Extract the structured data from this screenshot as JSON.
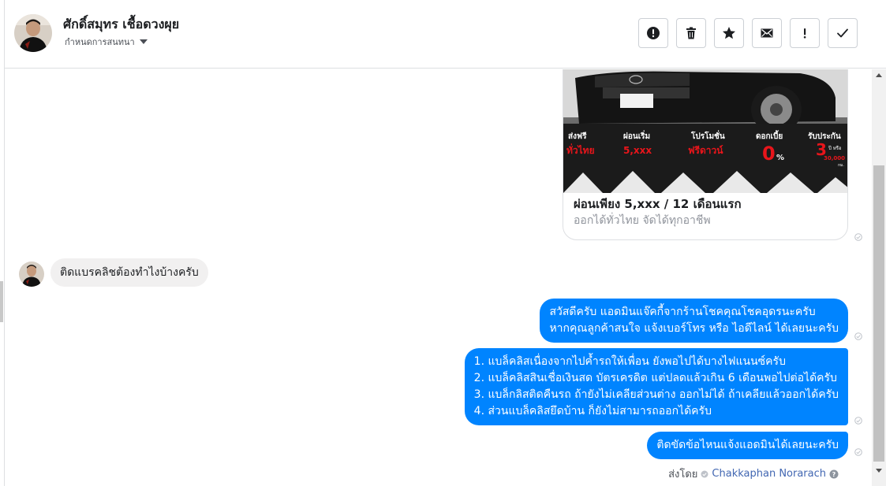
{
  "header": {
    "contact_name": "ศักดิ์สมุทร เชื้อดวงผุย",
    "assign_label": "กำหนดการสนทนา",
    "toolbar_icons": [
      "alert-circle-icon",
      "trash-icon",
      "star-icon",
      "envelope-icon",
      "exclamation-icon",
      "check-icon"
    ]
  },
  "thread": {
    "card": {
      "promo_labels": [
        "ส่งฟรี",
        "ทั่วไทย",
        "ผ่อนเริ่ม",
        "5,xxx",
        "โปรโมชั่น",
        "ฟรีดาวน์",
        "ดอกเบี้ย",
        "0",
        "%",
        "รับประกัน",
        "3",
        "ปี หรือ",
        "30,000",
        "กม."
      ],
      "title": "ผ่อนเพียง 5,xxx / 12 เดือนแรก",
      "subtitle": "ออกได้ทั่วไทย จัดได้ทุกอาชีพ"
    },
    "incoming_message": "ติดแบรคลิชต้องทำไงบ้างครับ",
    "outgoing": [
      {
        "lines": [
          "สวัสดีครับ แอดมินแจ๊คกี้จากร้านโชคคุณโชคอุดรนะครับ",
          "หากคุณลูกค้าสนใจ แจ้งเบอร์โทร หรือ ไอดีไลน์ ได้เลยนะครับ"
        ]
      },
      {
        "lines": [
          "1. แบล็คลิสเนื่องจากไปค้ำรถให้เพื่อน ยังพอไปได้บางไฟแนนซ์ครับ",
          "2. แบล็คลิสสินเชื่อเงินสด บัตรเครดิต แต่ปลดแล้วเกิน 6 เดือนพอไปต่อได้ครับ",
          "3. แบล็กลิสติดคืนรถ ถ้ายังไม่เคลียส่วนต่าง ออกไม่ได้ ถ้าเคลียแล้วออกได้ครับ",
          "4. ส่วนแบล็คลิสยึดบ้าน ก็ยังไม่สามารถออกได้ครับ"
        ]
      },
      {
        "lines": [
          "ติดขัดข้อไหนแจ้งแอดมินได้เลยนะครับ"
        ]
      }
    ],
    "sent_by_label": "ส่งโดย",
    "sent_by_name": "Chakkaphan Norarach"
  },
  "colors": {
    "outgoing_bubble": "#0084ff",
    "incoming_bubble": "#f1f0f0",
    "promo_red": "#e8151b",
    "link_blue": "#4267b2"
  }
}
